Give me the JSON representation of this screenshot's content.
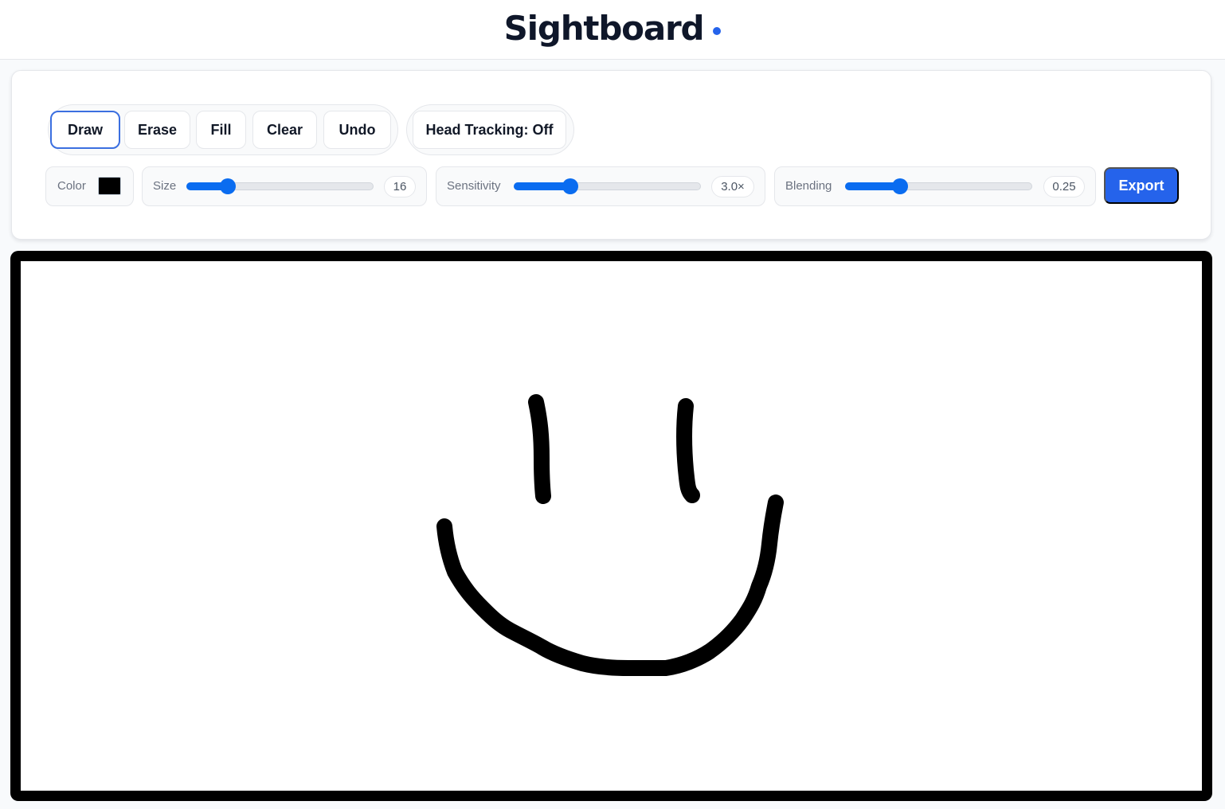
{
  "app": {
    "title": "Sightboard"
  },
  "tools": [
    {
      "id": "draw",
      "label": "Draw",
      "active": true
    },
    {
      "id": "erase",
      "label": "Erase",
      "active": false
    },
    {
      "id": "fill",
      "label": "Fill",
      "active": false
    },
    {
      "id": "clear",
      "label": "Clear",
      "active": false
    },
    {
      "id": "undo",
      "label": "Undo",
      "active": false
    }
  ],
  "head_tracking": {
    "label": "Head Tracking: Off"
  },
  "controls": {
    "color": {
      "label": "Color",
      "value": "#000000"
    },
    "size": {
      "label": "Size",
      "value_text": "16",
      "fraction": 0.22
    },
    "sensitivity": {
      "label": "Sensitivity",
      "value_text": "3.0×",
      "fraction": 0.3
    },
    "blending": {
      "label": "Blending",
      "value_text": "0.25",
      "fraction": 0.29
    }
  },
  "export": {
    "label": "Export"
  },
  "colors": {
    "accent": "#2563eb",
    "slider": "#0a6cf0",
    "stroke": "#000000"
  },
  "canvas": {
    "drawing": "smiley face sketch in black strokes"
  }
}
